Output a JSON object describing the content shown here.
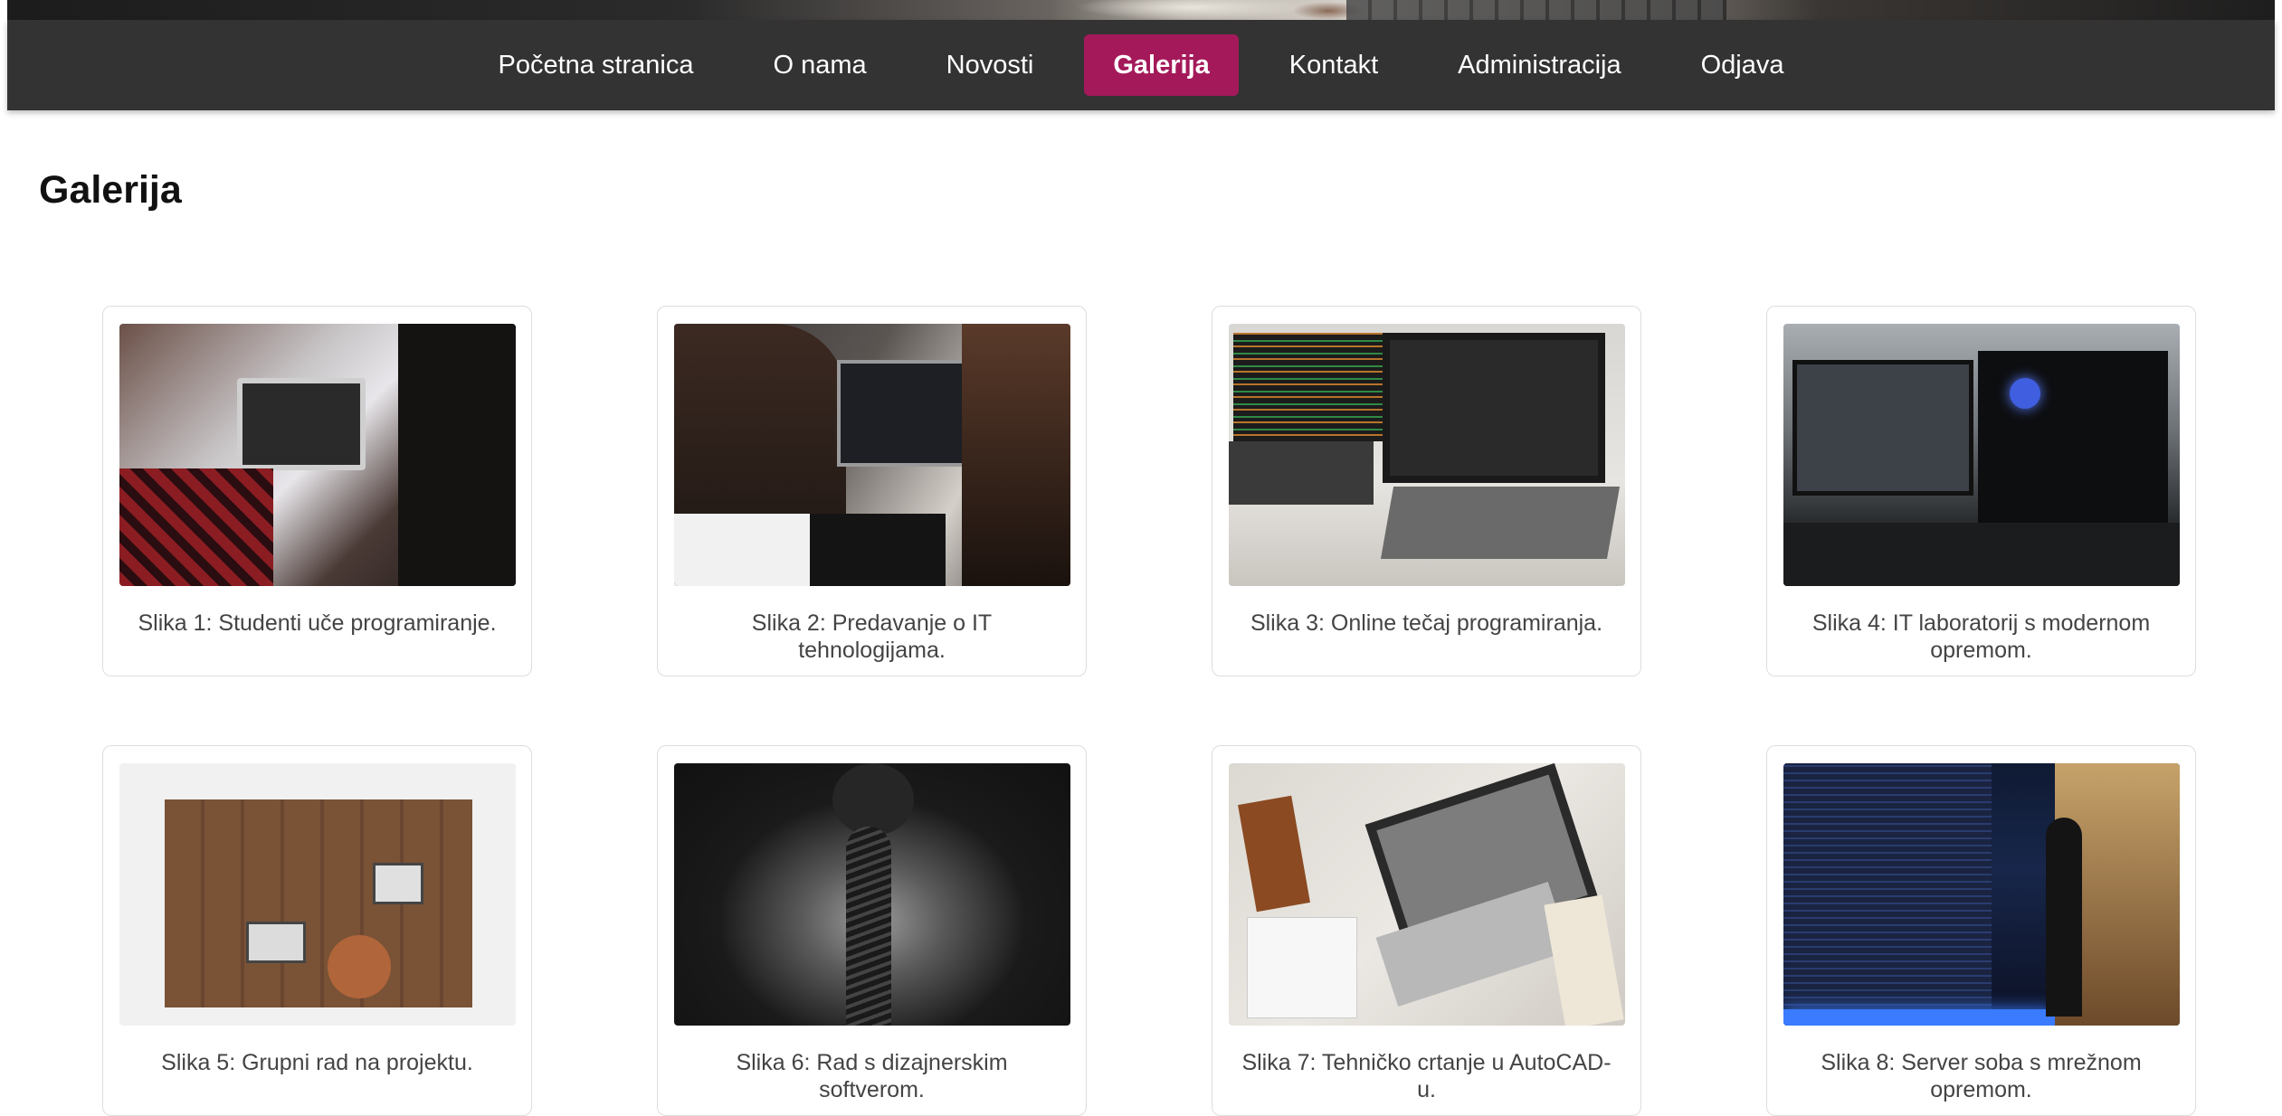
{
  "nav": {
    "items": [
      {
        "label": "Početna stranica",
        "active": false
      },
      {
        "label": "O nama",
        "active": false
      },
      {
        "label": "Novosti",
        "active": false
      },
      {
        "label": "Galerija",
        "active": true
      },
      {
        "label": "Kontakt",
        "active": false
      },
      {
        "label": "Administracija",
        "active": false
      },
      {
        "label": "Odjava",
        "active": false
      }
    ]
  },
  "page": {
    "title": "Galerija"
  },
  "gallery": {
    "items": [
      {
        "caption": "Slika 1: Studenti uče programiranje."
      },
      {
        "caption": "Slika 2: Predavanje o IT tehnologijama."
      },
      {
        "caption": "Slika 3: Online tečaj programiranja."
      },
      {
        "caption": "Slika 4: IT laboratorij s modernom opremom."
      },
      {
        "caption": "Slika 5: Grupni rad na projektu."
      },
      {
        "caption": "Slika 6: Rad s dizajnerskim softverom."
      },
      {
        "caption": "Slika 7: Tehničko crtanje u AutoCAD-u."
      },
      {
        "caption": "Slika 8: Server soba s mrežnom opremom."
      }
    ]
  },
  "colors": {
    "navbar_bg": "#333333",
    "nav_active_bg": "#a4195a",
    "nav_text": "#ffffff",
    "caption_text": "#444444"
  }
}
